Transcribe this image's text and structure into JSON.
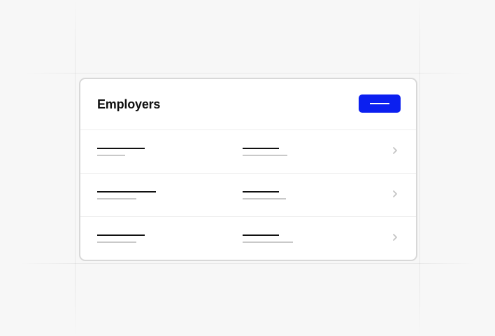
{
  "card": {
    "title": "Employers"
  },
  "header_button": {
    "icon": "placeholder-line"
  },
  "rows": [
    {
      "icon": "chevron-right-icon"
    },
    {
      "icon": "chevron-right-icon"
    },
    {
      "icon": "chevron-right-icon"
    }
  ],
  "colors": {
    "background": "#f7f7f7",
    "card": "#ffffff",
    "card_border": "#d8d8d8",
    "accent": "#0b1ff0",
    "text_primary": "#111111",
    "text_placeholder": "#c9c9c9",
    "chevron": "#c4c4c4"
  }
}
